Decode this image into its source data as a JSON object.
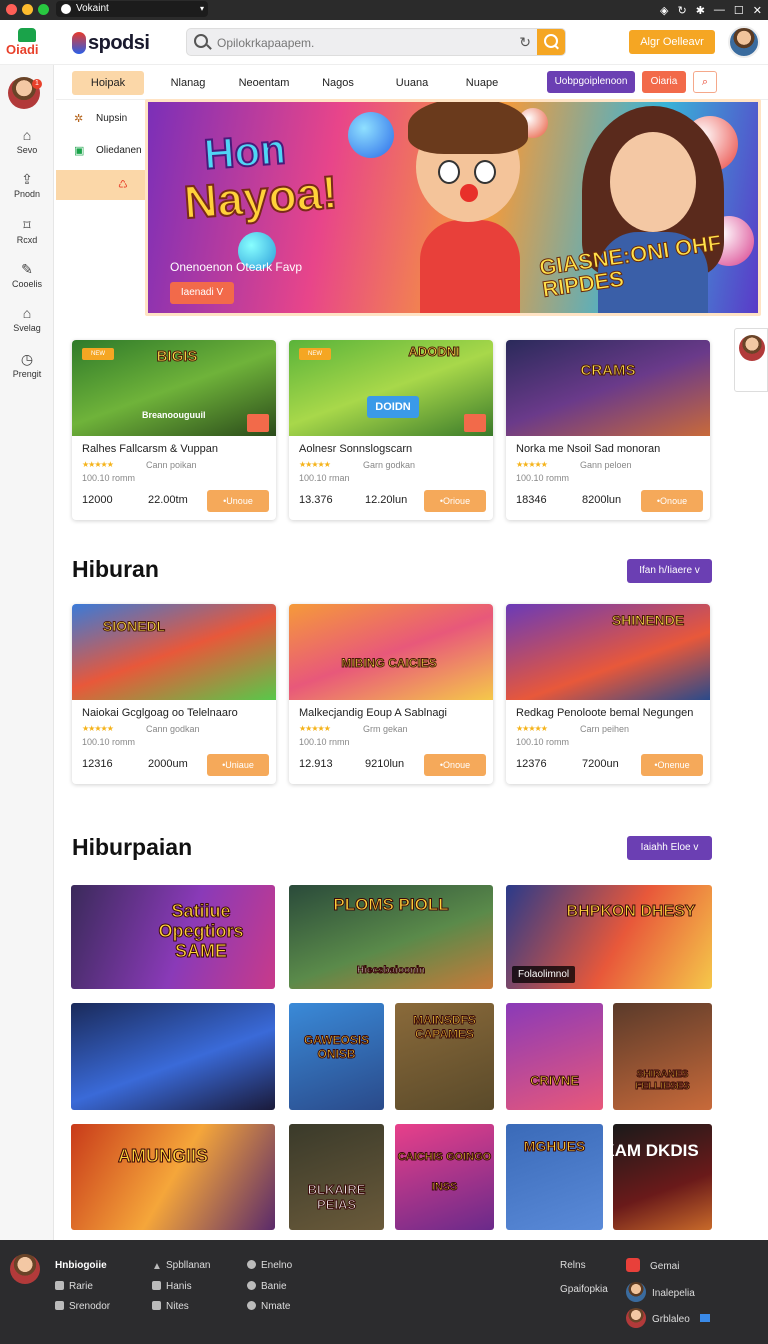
{
  "titlebar": {
    "tab_label": "Vokaint"
  },
  "header": {
    "logo_left": "Oiadi",
    "logo_main": "spodsi",
    "search_placeholder": "Opilokrkapaapem.",
    "signin_label": "Algr Oelleavr"
  },
  "sidebar": {
    "badge": "1",
    "items": [
      {
        "label": "Sevo",
        "icon": "home-icon"
      },
      {
        "label": "Pnodn",
        "icon": "upload-icon"
      },
      {
        "label": "Rcxd",
        "icon": "bookmark-icon"
      },
      {
        "label": "Cooelis",
        "icon": "pen-icon"
      },
      {
        "label": "Svelag",
        "icon": "home-outline-icon"
      },
      {
        "label": "Prengit",
        "icon": "clock-icon"
      }
    ]
  },
  "category_nav": {
    "items": [
      "Hoipak",
      "Nlanag",
      "Neoentam",
      "Nagos",
      "Uuana",
      "Nuape"
    ],
    "purple_button": "Uobpgoiplenoon",
    "red_button": "Oiaria"
  },
  "submenu": {
    "items": [
      "Nupsin",
      "Oliedanen"
    ]
  },
  "hero": {
    "title_line1": "Hon",
    "title_line2": "Nayoa!",
    "subtitle": "Onenoenon Oteark Favp",
    "cta_label": "Iaenadi V",
    "side_text": "GIASNE:ONI OHF RIPDES"
  },
  "featured_cards": [
    {
      "tag": "NEW",
      "img_title": "BIGIS",
      "img_sub": "Breanoouguuil",
      "name": "Ralhes Fallcarsm & Vuppan",
      "rating_sub": "Cann poikan",
      "meta": "100.10 romm",
      "price1": "12000",
      "price2": "22.00tm",
      "button": "•Unoue"
    },
    {
      "tag": "NEW",
      "img_title": "ADODNI",
      "img_sub": "DOIDN",
      "name": "Aolnesr Sonnslogscarn",
      "rating_sub": "Garn godkan",
      "meta": "100.10 rman",
      "price1": "13.376",
      "price2": "12.20lun",
      "button": "•Orioue"
    },
    {
      "tag": "",
      "img_title": "CRAMS",
      "img_sub": "",
      "name": "Norka me Nsoil Sad monoran",
      "rating_sub": "Gann peloen",
      "meta": "100.10 romm",
      "price1": "18346",
      "price2": "8200lun",
      "button": "•Onoue"
    }
  ],
  "section1": {
    "title": "Hiburan",
    "more_label": "Ifan h/Iiaere v",
    "cards": [
      {
        "img_title": "SIONEDL",
        "name": "Naiokai Gcglgoag oo Telelnaaro",
        "rating_sub": "Cann godkan",
        "meta": "100.10 romm",
        "price1": "12316",
        "price2": "2000um",
        "button": "•Uniaue"
      },
      {
        "img_title": "MIBING CAICIES",
        "name": "Malkecjandig Eoup A Sablnagi",
        "rating_sub": "Grm gekan",
        "meta": "100.10 rnmn",
        "price1": "12.913",
        "price2": "9210lun",
        "button": "•Onoue"
      },
      {
        "img_title": "SHINENDE",
        "name": "Redkag Penoloote bemal Negungen",
        "rating_sub": "Carn peihen",
        "meta": "100.10 romm",
        "price1": "12376",
        "price2": "7200un",
        "button": "•Onenue"
      }
    ]
  },
  "section2": {
    "title": "Hiburpaian",
    "more_label": "Iaiahh Eloe v",
    "tiles": [
      {
        "title": "Satiiue Opegtiors SAME",
        "label": ""
      },
      {
        "title": "PLOMS PIOLL",
        "label": "Hiecsbaioonin"
      },
      {
        "title": "BHPKON DHESY",
        "label": "Folaolimnol"
      },
      {
        "title": "",
        "label": ""
      },
      {
        "title": "GAWEOSIS ONISB",
        "label": ""
      },
      {
        "title": "MAINSDFS CAPAMES",
        "label": ""
      },
      {
        "title": "CRIVNE",
        "label": ""
      },
      {
        "title": "SHIRANES FELLIESES",
        "label": ""
      },
      {
        "title": "AMUNGIIS",
        "label": ""
      },
      {
        "title": "BLKAIRE PEIAS",
        "label": ""
      },
      {
        "title": "CAICHIS GOINGO INSS",
        "label": ""
      },
      {
        "title": "MGHUES",
        "label": ""
      },
      {
        "title": "KAM DKDIS",
        "label": ""
      }
    ]
  },
  "footer": {
    "brand": "Hnbiogoiie",
    "col1": [
      "Rarie",
      "Srenodor"
    ],
    "col2": [
      "Spbllanan",
      "Hanis",
      "Nites"
    ],
    "col3": [
      "Enelno",
      "Banie",
      "Nmate"
    ],
    "col4": [
      "Relns",
      "Gpaifopkia"
    ],
    "col5": [
      "Gemai",
      "Inalepelia",
      "Grblaleo"
    ]
  },
  "colors": {
    "accent": "#f5a623",
    "purple": "#6b3fb3",
    "red": "#e8402a",
    "footer_bg": "#2c2c2e"
  }
}
